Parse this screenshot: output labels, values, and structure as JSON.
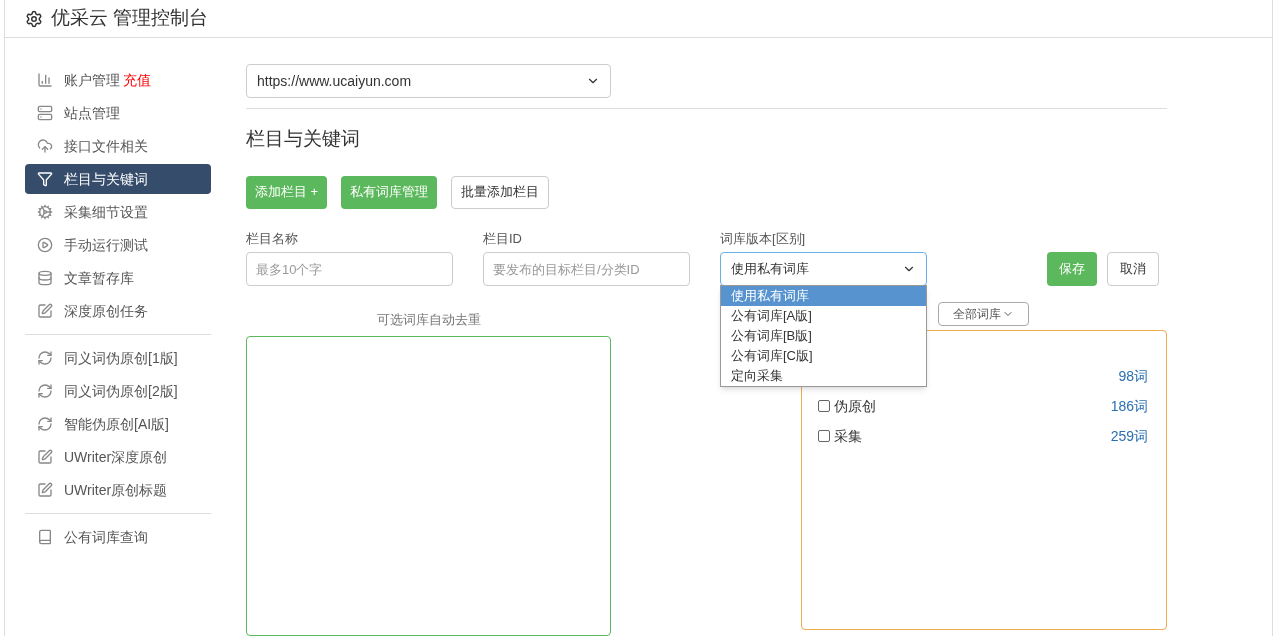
{
  "header": {
    "title": "优采云 管理控制台"
  },
  "sidebar": {
    "groups": [
      {
        "items": [
          {
            "label": "账户管理",
            "badge": "充值",
            "selected": false
          },
          {
            "label": "站点管理",
            "selected": false
          },
          {
            "label": "接口文件相关",
            "selected": false
          },
          {
            "label": "栏目与关键词",
            "selected": true
          },
          {
            "label": "采集细节设置",
            "selected": false
          },
          {
            "label": "手动运行测试",
            "selected": false
          },
          {
            "label": "文章暂存库",
            "selected": false
          },
          {
            "label": "深度原创任务",
            "selected": false
          }
        ]
      },
      {
        "items": [
          {
            "label": "同义词伪原创[1版]",
            "selected": false
          },
          {
            "label": "同义词伪原创[2版]",
            "selected": false
          },
          {
            "label": "智能伪原创[AI版]",
            "selected": false
          },
          {
            "label": "UWriter深度原创",
            "selected": false
          },
          {
            "label": "UWriter原创标题",
            "selected": false
          }
        ]
      },
      {
        "items": [
          {
            "label": "公有词库查询",
            "selected": false
          }
        ]
      }
    ]
  },
  "site_select": {
    "value": "https://www.ucaiyun.com"
  },
  "section_title": "栏目与关键词",
  "actions": [
    {
      "label": "添加栏目 +",
      "kind": "primary"
    },
    {
      "label": "私有词库管理",
      "kind": "primary"
    },
    {
      "label": "批量添加栏目",
      "kind": "default"
    }
  ],
  "form": {
    "name_field": {
      "label": "栏目名称",
      "placeholder": "最多10个字"
    },
    "id_field": {
      "label": "栏目ID",
      "placeholder": "要发布的目标栏目/分类ID"
    },
    "library_select": {
      "label": "词库版本[区别]",
      "value": "使用私有词库",
      "expanded": true,
      "options": [
        {
          "label": "使用私有词库",
          "selected": true
        },
        {
          "label": "公有词库[A版]",
          "selected": false
        },
        {
          "label": "公有词库[B版]",
          "selected": false
        },
        {
          "label": "公有词库[C版]",
          "selected": false
        },
        {
          "label": "定向采集",
          "selected": false
        }
      ]
    },
    "save": "保存",
    "cancel": "取消"
  },
  "hint": "可选词库自动去重",
  "library_filter": {
    "value": "全部词库"
  },
  "libraries": [
    {
      "count": "98词"
    },
    {
      "label": "伪原创",
      "count": "186词",
      "checked": false
    },
    {
      "label": "采集",
      "count": "259词",
      "checked": false
    }
  ]
}
